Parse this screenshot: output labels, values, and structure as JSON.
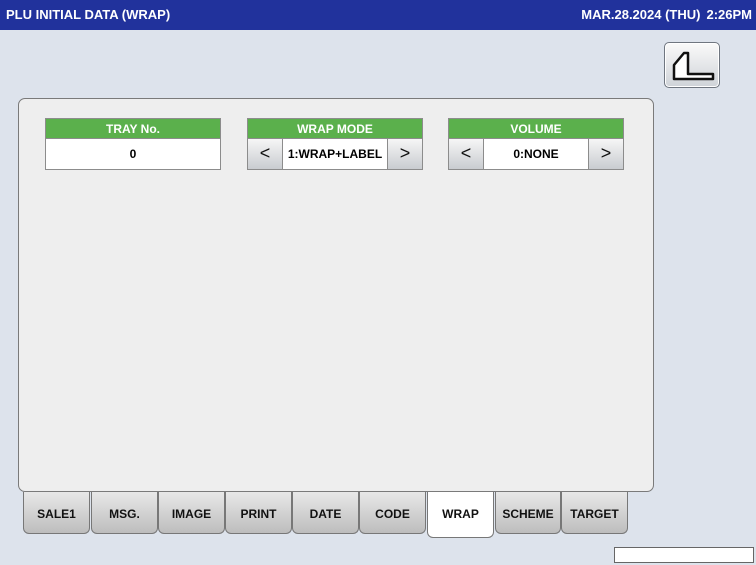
{
  "header": {
    "title": "PLU INITIAL DATA (WRAP)",
    "date": "MAR.28.2024 (THU)",
    "time": "2:26PM"
  },
  "back_button": {
    "icon": "return-arrow-icon"
  },
  "fields": {
    "tray_no": {
      "label": "TRAY No.",
      "value": "0"
    },
    "wrap_mode": {
      "label": "WRAP MODE",
      "value": "1:WRAP+LABEL",
      "prev": "<",
      "next": ">"
    },
    "volume": {
      "label": "VOLUME",
      "value": "0:NONE",
      "prev": "<",
      "next": ">"
    }
  },
  "tabs": [
    {
      "label": "SALE1"
    },
    {
      "label": "MSG."
    },
    {
      "label": "IMAGE"
    },
    {
      "label": "PRINT"
    },
    {
      "label": "DATE"
    },
    {
      "label": "CODE"
    },
    {
      "label": "WRAP",
      "active": true
    },
    {
      "label": "SCHEME"
    },
    {
      "label": "TARGET"
    }
  ],
  "colors": {
    "title_bar": "#21329c",
    "field_header": "#5bb04c",
    "background": "#dde3ec",
    "panel": "#eeeeee"
  }
}
